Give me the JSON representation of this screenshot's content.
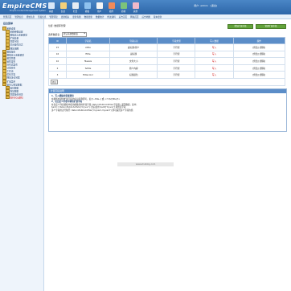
{
  "brand": {
    "logo": "EmpireCMS",
    "logo_sub": "Empire Content Management System"
  },
  "topnav": [
    {
      "label": "系统",
      "color": "#d9e7f7",
      "icon": "system-icon"
    },
    {
      "label": "信息",
      "color": "#f4d07a",
      "icon": "info-icon"
    },
    {
      "label": "栏目",
      "color": "#e7ecf2",
      "icon": "column-icon"
    },
    {
      "label": "模板",
      "color": "#8fc2ef",
      "icon": "template-icon"
    },
    {
      "label": "用户",
      "color": "#f5f5f5",
      "icon": "user-icon"
    },
    {
      "label": "插件",
      "color": "#f08a5a",
      "icon": "plugin-icon"
    },
    {
      "label": "商城",
      "color": "#7cc47a",
      "icon": "shop-icon"
    },
    {
      "label": "其他",
      "color": "#f2b9c9",
      "icon": "other-icon"
    }
  ],
  "user": {
    "label": "用户:",
    "name": "admin",
    "logout": "[退出]"
  },
  "subbar": [
    "管理首页",
    "管理信息",
    "增加信息",
    "签发信息",
    "管理评论",
    "更新相关",
    "更新专题",
    "数据更新",
    "数据统计",
    "修改资料",
    "后台首页",
    "网站首页",
    "后台地图",
    "版本更新"
  ],
  "sidebar": {
    "title": "后台菜单",
    "items": [
      {
        "label": "系统设置",
        "level": 0
      },
      {
        "label": "系统参数设置",
        "level": 1
      },
      {
        "label": "数据表与系统模型",
        "level": 1
      },
      {
        "label": "扩展变量",
        "level": 1
      },
      {
        "label": "管理字段",
        "level": 1
      },
      {
        "label": "后台操作日志",
        "level": 1
      },
      {
        "label": "网站地图",
        "level": 1
      },
      {
        "label": "数据备份",
        "level": 0
      },
      {
        "label": "数据库与系统模型",
        "level": 0
      },
      {
        "label": "模型管理",
        "level": 0
      },
      {
        "label": "远程发布",
        "level": 0
      },
      {
        "label": "分布式发布",
        "level": 0
      },
      {
        "label": "计划任务",
        "level": 0
      },
      {
        "label": "工作流",
        "level": 0
      },
      {
        "label": "优化方案",
        "level": 0
      },
      {
        "label": "网站多访问端",
        "level": 0
      },
      {
        "label": "扩展菜单",
        "level": 0
      },
      {
        "label": "备份与恢复数据",
        "level": 0
      },
      {
        "label": "备份数据",
        "level": 1
      },
      {
        "label": "恢复数据",
        "level": 1
      },
      {
        "label": "管理备份目录",
        "level": 1
      },
      {
        "label": "执行SQL语句",
        "level": 1,
        "selected": true
      }
    ]
  },
  "main": {
    "breadcrumb": "位置: 数据库管理",
    "add_button": "增加扩展字段",
    "manage_button": "管理扩展字段",
    "filter_label": "选择数据表:",
    "filter_value": "默认系统数据表",
    "columns": [
      "ID",
      "字段名",
      "字段标识",
      "字段类型",
      "写入数据",
      "操作"
    ],
    "rows": [
      {
        "id": "15",
        "field": "stitle",
        "label": "副标题/简介",
        "type": "字符型",
        "mark": "写入",
        "ops": "[修改] [删除]"
      },
      {
        "id": "16",
        "field": "ftitle",
        "label": "副标题",
        "type": "字符型",
        "mark": "写入",
        "ops": "[修改] [删除]"
      },
      {
        "id": "10",
        "field": "filesize",
        "label": "文件大小",
        "type": "字符型",
        "mark": "写入",
        "ops": "[修改] [删除]"
      },
      {
        "id": "2",
        "field": "fstitle",
        "label": "简介内容",
        "type": "字符型",
        "mark": "写入",
        "ops": "[修改] [删除]"
      },
      {
        "id": "3",
        "field": "ftitlecolor",
        "label": "标题颜色",
        "type": "字符型",
        "mark": "写入",
        "ops": "[修改] [删除]"
      }
    ],
    "pager": "提交"
  },
  "tips": {
    "header": "扩展字段说明",
    "lines": [
      "1、写入模板的变量调用",
      "在模板中调用扩展字段的标识名称即可，如 [!--title--] 或 <?=$r[title]?>",
      "2、在自定义列表中调用扩展字段",
      "在自定义列表模板中使用函数调用扩展字段: ReturnPublicAddVar(字段名) 返回数组，其中：",
      "$add = ReturnPublicAddVar('myvar'); 然后使用 $add['myvar'] 调用该字段",
      "多个字段用逗号隔开: ReturnPublicAddVar('myvar1,myvar2') 即可返回多个字段的值"
    ]
  },
  "watermark": "www.ehuiblog.com"
}
